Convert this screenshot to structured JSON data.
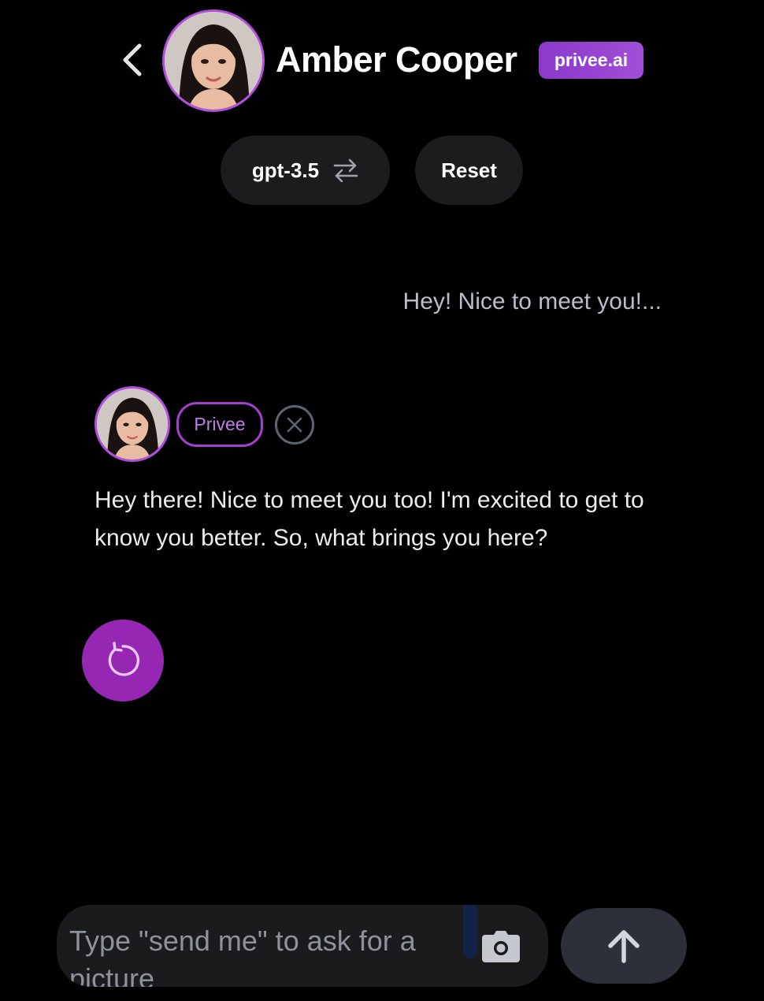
{
  "header": {
    "back_icon": "chevron-left-icon",
    "avatar_alt": "Amber Cooper avatar",
    "character_name": "Amber Cooper",
    "brand_badge": "privee.ai"
  },
  "controls": {
    "model_label": "gpt-3.5",
    "model_switch_icon": "swap-arrows-icon",
    "reset_label": "Reset"
  },
  "messages": {
    "user": {
      "text": "Hey! Nice to meet you!..."
    },
    "bot": {
      "sender_tag": "Privee",
      "close_icon": "close-circle-icon",
      "text": "Hey there! Nice to meet you too! I'm excited to get to know you better. So, what brings you here?",
      "regenerate_icon": "refresh-icon"
    }
  },
  "composer": {
    "placeholder": "Type \"send me\" to ask for a picture",
    "camera_icon": "camera-icon",
    "send_icon": "arrow-up-icon"
  },
  "colors": {
    "background": "#000000",
    "accent": "#9627b3",
    "avatar_ring": "#b14ee0",
    "pill_bg": "#1c1c1f",
    "muted_text": "#b9bec9"
  }
}
